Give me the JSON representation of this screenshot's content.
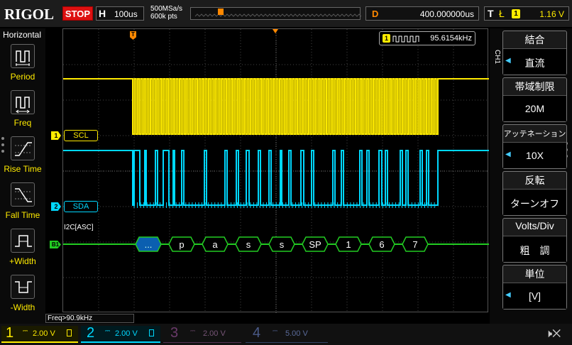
{
  "app": {
    "brand": "RIGOL",
    "run_status": "STOP"
  },
  "timebase": {
    "label": "H",
    "value": "100us",
    "sample_rate": "500MSa/s",
    "mem_depth": "600k pts"
  },
  "delay": {
    "label": "D",
    "value": "400.000000us"
  },
  "trigger": {
    "label": "T",
    "edge": "Ł",
    "channel": "1",
    "level": "1.16 V"
  },
  "markers": {
    "trigger_tab": "T"
  },
  "left_panel": {
    "header": "Horizontal",
    "items": [
      {
        "label": "Period",
        "icon": "period-icon"
      },
      {
        "label": "Freq",
        "icon": "freq-icon"
      },
      {
        "label": "Rise Time",
        "icon": "rise-time-icon"
      },
      {
        "label": "Fall Time",
        "icon": "fall-time-icon"
      },
      {
        "label": "+Width",
        "icon": "pos-width-icon"
      },
      {
        "label": "-Width",
        "icon": "neg-width-icon"
      }
    ]
  },
  "waveform": {
    "freq_counter": {
      "channel": "1",
      "value": "95.6154kHz"
    },
    "ch1_label": "SCL",
    "ch1_marker": "1",
    "ch2_label": "SDA",
    "ch2_marker": "2",
    "bus_label": "I2C[ASC]",
    "bus_marker": "B1",
    "decode_packets": [
      "...",
      "p",
      "a",
      "s",
      "s",
      "SP",
      "1",
      "6",
      "7"
    ],
    "right_trigger_marker": "T",
    "freq_readout": "Freq>90.9kHz"
  },
  "right_menu": {
    "channel_tab": "CH1",
    "items": [
      {
        "title": "結合",
        "value": "直流",
        "has_arrow": true
      },
      {
        "title": "帯域制限",
        "value": "20M",
        "has_arrow": false
      },
      {
        "title": "アッテネーション",
        "value": "10X",
        "has_arrow": true
      },
      {
        "title": "反転",
        "value": "ターンオフ",
        "has_arrow": false
      },
      {
        "title": "Volts/Div",
        "value": "粗　調",
        "has_arrow": false
      },
      {
        "title": "単位",
        "value": "[V]",
        "has_arrow": true
      }
    ]
  },
  "channels": [
    {
      "num": "1",
      "scale": "2.00 V",
      "color": "#ffeb00",
      "active": true
    },
    {
      "num": "2",
      "scale": "2.00 V",
      "color": "#00d8ff",
      "active": true
    },
    {
      "num": "3",
      "scale": "2.00 V",
      "color": "#cc44cc",
      "active": false
    },
    {
      "num": "4",
      "scale": "5.00 V",
      "color": "#3f7bff",
      "active": false
    }
  ],
  "colors": {
    "ch1": "#ffeb00",
    "ch2": "#00d8ff",
    "bus": "#22cc22",
    "trigger": "#ff8a00",
    "decode_fill": "#0b5fb0"
  }
}
